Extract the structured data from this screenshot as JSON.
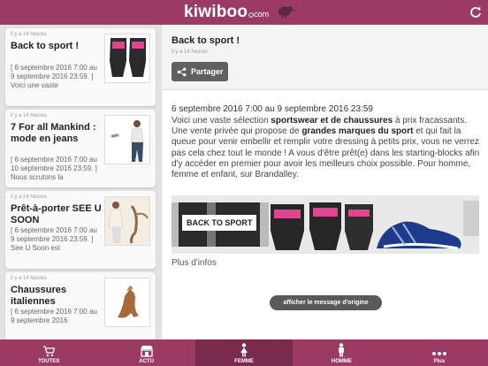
{
  "header": {
    "logo_word": "kiwiboo",
    "logo_suffix": "com",
    "colors": {
      "brand": "#9b3b64",
      "brand_dark": "#7a2a4d"
    }
  },
  "sidebar": {
    "items": [
      {
        "time": "il y a 14 heures",
        "title": "Back to sport !",
        "excerpt": "[ 6 septembre 2016 7:00 au 9 septembre 2016 23:59. ] Voici une vaste"
      },
      {
        "time": "il y a 14 heures",
        "title": "7 For all Mankind : mode en jeans",
        "excerpt": "[ 6 septembre 2016 7:00 au 10 septembre 2016 23:59. ] Nous scrutons la"
      },
      {
        "time": "il y a 14 heures",
        "title": "Prêt-à-porter SEE U SOON",
        "excerpt": "[ 6 septembre 2016 7:00 au 9 septembre 2016 23:59. ] See U Soon est"
      },
      {
        "time": "il y a 14 heures",
        "title": "Chaussures italiennes",
        "excerpt": "[ 6 septembre 2016 7:00 au 9 septembre 2016"
      }
    ]
  },
  "main": {
    "title": "Back to sport !",
    "time": "il y a 14 heures",
    "share_label": "Partager",
    "dates": "6 septembre 2016 7:00 au 9 septembre 2016 23:59",
    "text": {
      "p1": "Voici une vaste sélection ",
      "b1": "sportswear et de chaussures",
      "p2": " à prix fracassants. Une vente privée qui propose de ",
      "b2": "grandes marques du sport",
      "p3": " et qui fait la queue pour venir embellir et remplir votre dressing à petits prix, vous ne verrez pas cela chez tout le monde ! A vous d'être prêt(e) dans les starting-blocks afin d'y accéder en premier pour avoir les meilleurs choix possible. Pour homme, femme et enfant, sur Brandalley."
    },
    "banner_label": "BACK TO SPORT",
    "more_label": "Plus d'infos",
    "original_button": "afficher le message d'origine"
  },
  "tabbar": {
    "tabs": [
      {
        "label": "TOUTES",
        "icon": "cart-icon",
        "active": false
      },
      {
        "label": "ACTU",
        "icon": "shop-icon",
        "active": false
      },
      {
        "label": "FEMME",
        "icon": "woman-icon",
        "active": true
      },
      {
        "label": "HOMME",
        "icon": "man-icon",
        "active": false
      },
      {
        "label": "Plus",
        "icon": "more-icon",
        "active": false
      }
    ]
  }
}
